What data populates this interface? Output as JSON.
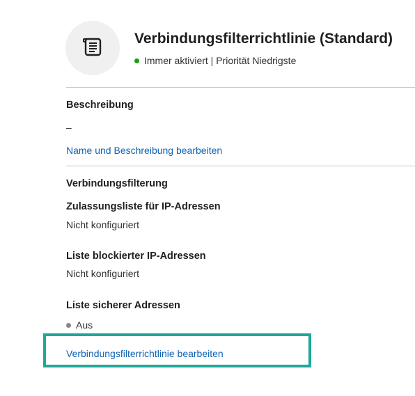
{
  "header": {
    "title": "Verbindungsfilterrichtlinie (Standard)",
    "status_text": "Immer aktiviert | Priorität Niedrigste",
    "status_color": "#13a10e",
    "icon": "scroll-icon"
  },
  "description": {
    "heading": "Beschreibung",
    "value": "–",
    "edit_link": "Name und Beschreibung bearbeiten"
  },
  "connection_filter": {
    "heading": "Verbindungsfilterung",
    "ip_allow": {
      "label": "Zulassungsliste für IP-Adressen",
      "value": "Nicht konfiguriert"
    },
    "ip_block": {
      "label": "Liste blockierter IP-Adressen",
      "value": "Nicht konfiguriert"
    },
    "safe_list": {
      "label": "Liste sicherer Adressen",
      "value": "Aus",
      "dot_color": "#8a8886"
    },
    "edit_link": "Verbindungsfilterrichtlinie bearbeiten"
  },
  "colors": {
    "link": "#0f62b5",
    "highlight": "#1ea89a"
  }
}
